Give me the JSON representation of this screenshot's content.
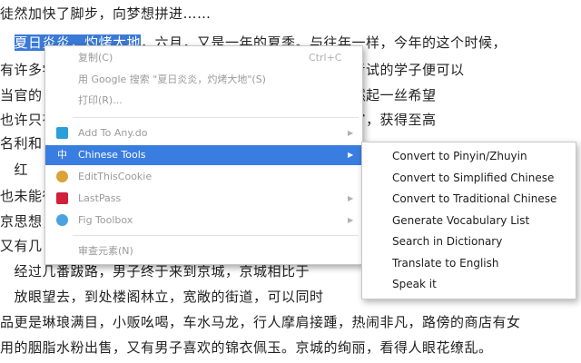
{
  "article": {
    "lines": [
      {
        "before": "",
        "selected": "",
        "after": "徒然加快了脚步，向梦想拼进……"
      },
      {
        "before": "　",
        "selected": "夏日炎炎，灼烤大地",
        "after": "，六月，又是一年的夏季。与往年一样，今年的这个时候，"
      },
      {
        "before": "有许多学子",
        "selected": "",
        "after": "　　　　　　　　　　　　　　，能通过科举考试的学子便可以"
      },
      {
        "before": "当官的",
        "selected": "",
        "after": "　　　　　　　　　　　　　　出路那样，在心中燃起一丝希望"
      },
      {
        "before": "也许只有",
        "selected": "",
        "after": "　　　　　　　　　　　　　举考试才能入朝为官，获得至高"
      },
      {
        "before": "名利和",
        "selected": "",
        "after": ""
      },
      {
        "before": "　红",
        "selected": "",
        "after": ""
      },
      {
        "before": "也未能往",
        "selected": "",
        "after": ""
      },
      {
        "before": "京思想，",
        "selected": "",
        "after": ""
      },
      {
        "before": "又有几",
        "selected": "",
        "after": ""
      },
      {
        "before": "　经过",
        "selected": "",
        "after": "几番跋路，男子终于来到京城，京城相比于"
      },
      {
        "before": "　放眼望去，到处楼阁林立，宽敞的街道，可以同时",
        "selected": "",
        "after": ""
      },
      {
        "before": "品更是琳琅满目，小贩吆喝，车水马龙，行人摩肩接踵，热闹非凡，路傍的商店有女",
        "selected": "",
        "after": ""
      },
      {
        "before": "用的胭脂水粉出售，又有男子喜欢的锦衣佩玉。京城的绚丽，看得人眼花缭乱。",
        "selected": "",
        "after": ""
      }
    ]
  },
  "context_menu": {
    "items": [
      {
        "label": "复制(C)",
        "shortcut": "Ctrl+C"
      },
      {
        "label": "用 Google 搜索 \"夏日炎炎，灼烤大地\"(S)",
        "shortcut": ""
      },
      {
        "label": "打印(R)...",
        "shortcut": ""
      },
      {
        "label": "Add To Any.do",
        "shortcut": ""
      },
      {
        "label": "Chinese Tools",
        "shortcut": ""
      },
      {
        "label": "EditThisCookie",
        "shortcut": ""
      },
      {
        "label": "LastPass",
        "shortcut": ""
      },
      {
        "label": "Fig Toolbox",
        "shortcut": ""
      },
      {
        "label": "审查元素(N)",
        "shortcut": ""
      }
    ],
    "chinese_tools_glyph": "中",
    "arrow": "▶"
  },
  "submenu": {
    "items": [
      "Convert to Pinyin/Zhuyin",
      "Convert to Simplified Chinese",
      "Convert to Traditional Chinese",
      "Generate Vocabulary List",
      "Search in Dictionary",
      "Translate to English",
      "Speak it"
    ]
  },
  "colors": {
    "highlight": "#3a7de0",
    "selection": "#3a79d6",
    "anydo": "#2aa0d8",
    "cookie": "#d9a338",
    "lastpass": "#d0203a",
    "fig": "#4aa3e0"
  }
}
